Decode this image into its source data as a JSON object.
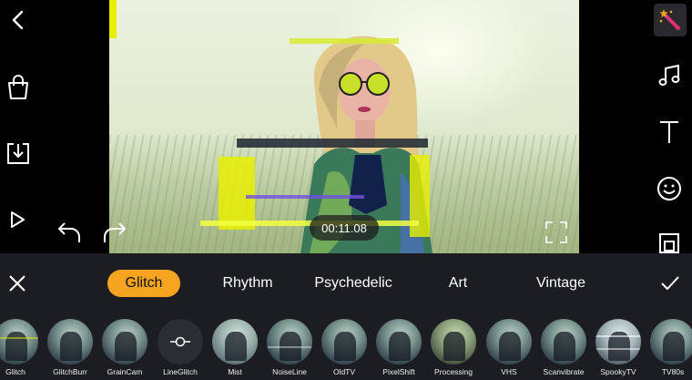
{
  "player": {
    "timecode": "00:11.08"
  },
  "left_toolbar": {
    "items": [
      "back",
      "store",
      "export",
      "play"
    ]
  },
  "right_toolbar": {
    "items": [
      "effects",
      "music",
      "text",
      "sticker",
      "canvas"
    ]
  },
  "effects_panel": {
    "tabs": [
      {
        "label": "Glitch",
        "active": true
      },
      {
        "label": "Rhythm",
        "active": false
      },
      {
        "label": "Psychedelic",
        "active": false
      },
      {
        "label": "Art",
        "active": false
      },
      {
        "label": "Vintage",
        "active": false
      }
    ],
    "effects": [
      {
        "label": "Glitch"
      },
      {
        "label": "GlitchBurr"
      },
      {
        "label": "GrainCam"
      },
      {
        "label": "LineGlitch",
        "selected": true
      },
      {
        "label": "Mist"
      },
      {
        "label": "NoiseLine"
      },
      {
        "label": "OldTV"
      },
      {
        "label": "PixelShift"
      },
      {
        "label": "Processing"
      },
      {
        "label": "VHS"
      },
      {
        "label": "Scanvibrate"
      },
      {
        "label": "SpookyTV"
      },
      {
        "label": "TV80s"
      }
    ]
  },
  "colors": {
    "accent": "#f7a520",
    "panel_bg": "#1c1d22",
    "glitch_yellow": "#e8f000",
    "magic_pink": "#e0307a"
  }
}
